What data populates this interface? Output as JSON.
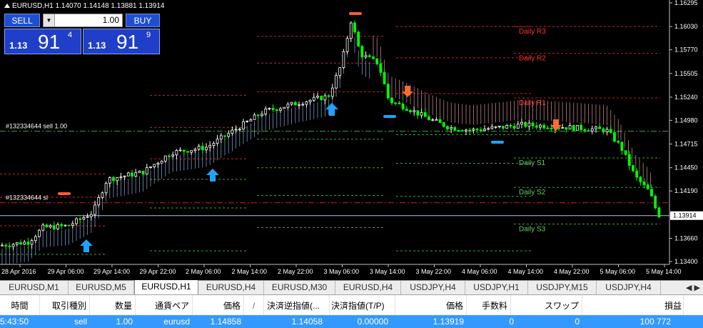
{
  "chart": {
    "title": "EURUSD,H1  1.14070 1.14148 1.13881 1.13914",
    "price_axis": [
      "1.16295",
      "1.16030",
      "1.15770",
      "1.15505",
      "1.15240",
      "1.14980",
      "1.14715",
      "1.14450",
      "1.14190",
      "1.13925",
      "1.13660",
      "1.13400"
    ],
    "current_price_label": "1.13914",
    "time_axis": [
      "28 Apr 2016",
      "29 Apr 06:00",
      "29 Apr 14:00",
      "29 Apr 22:00",
      "2 May 06:00",
      "2 May 14:00",
      "2 May 22:00",
      "3 May 06:00",
      "3 May 14:00",
      "3 May 22:00",
      "4 May 06:00",
      "4 May 14:00",
      "4 May 22:00",
      "5 May 06:00",
      "5 May 14:00"
    ],
    "pivot_labels": {
      "r3": "Daily R3",
      "r2": "Daily R2",
      "r1": "Daily R1",
      "s1": "Daily S1",
      "s2": "Daily S2",
      "s3": "Daily S3"
    },
    "order_labels": {
      "sell": "#132334644 sell 1.00",
      "sl": "#132334644 sl"
    },
    "colors": {
      "background": "#000000",
      "bull_candle": "#ffffff",
      "bear_candle": "#00ff00",
      "resistance": "#cc2222",
      "support": "#33aa33",
      "buy_arrow": "#1fa3ff",
      "sell_arrow": "#ff6a33",
      "cloud_up": "#9ec8ff",
      "cloud_down": "#ffb0b0"
    }
  },
  "one_click": {
    "sell_label": "SELL",
    "buy_label": "BUY",
    "lot": "1.00",
    "sell_price": {
      "small": "1.13",
      "big": "91",
      "sup": "4"
    },
    "buy_price": {
      "small": "1.13",
      "big": "91",
      "sup": "9"
    }
  },
  "tabs": [
    "EURUSD,M1",
    "EURUSD,M5",
    "EURUSD,H1",
    "EURUSD,H4",
    "EURUSD,M30",
    "EURUSD,H4",
    "USDJPY,H4",
    "USDJPY,H1",
    "USDJPY,M15",
    "USDJPY,H4"
  ],
  "active_tab": 2,
  "terminal": {
    "headers": {
      "time": "時間",
      "type": "取引種別",
      "volume": "数量",
      "symbol": "通貨ペア",
      "price": "価格",
      "sort_mark": "/",
      "sl": "決済逆指値(...",
      "tp": "決済指値(T/P)",
      "cur_price": "価格",
      "commission": "手数料",
      "swap": "スワップ",
      "profit": "損益"
    },
    "row": {
      "time": "5:43:50",
      "type": "sell",
      "volume": "1.00",
      "symbol": "eurusd",
      "price": "1.14858",
      "sl": "1.14058",
      "tp": "0.00000",
      "cur_price": "1.13919",
      "commission": "0",
      "swap": "0",
      "profit": "100 772"
    }
  }
}
